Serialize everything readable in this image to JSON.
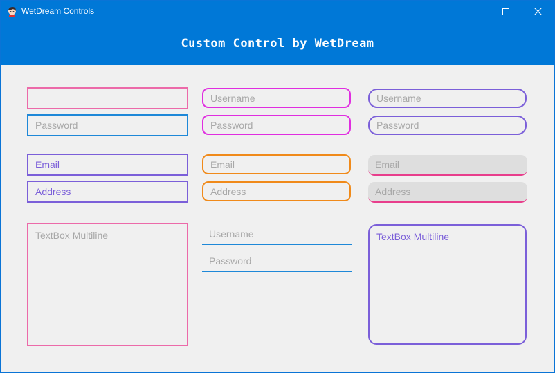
{
  "window": {
    "title": "WetDream Controls"
  },
  "header": {
    "title": "Custom Control by WetDream"
  },
  "colors": {
    "pink": "#ec6aa9",
    "blue": "#1e88d8",
    "purple": "#7b5fd9",
    "magenta": "#e02ee0",
    "orange": "#f08a1a",
    "flat_bg": "#dedede",
    "accent_title": "#0078d7"
  },
  "col1": {
    "field1": "",
    "password": "Password",
    "email": "Email",
    "address": "Address",
    "multiline": "TextBox Multiline"
  },
  "col2": {
    "username": "Username",
    "password": "Password",
    "email": "Email",
    "address": "Address",
    "ul_username": "Username",
    "ul_password": "Password"
  },
  "col3": {
    "username": "Username",
    "password": "Password",
    "email": "Email",
    "address": "Address",
    "multiline": "TextBox Multiline"
  }
}
